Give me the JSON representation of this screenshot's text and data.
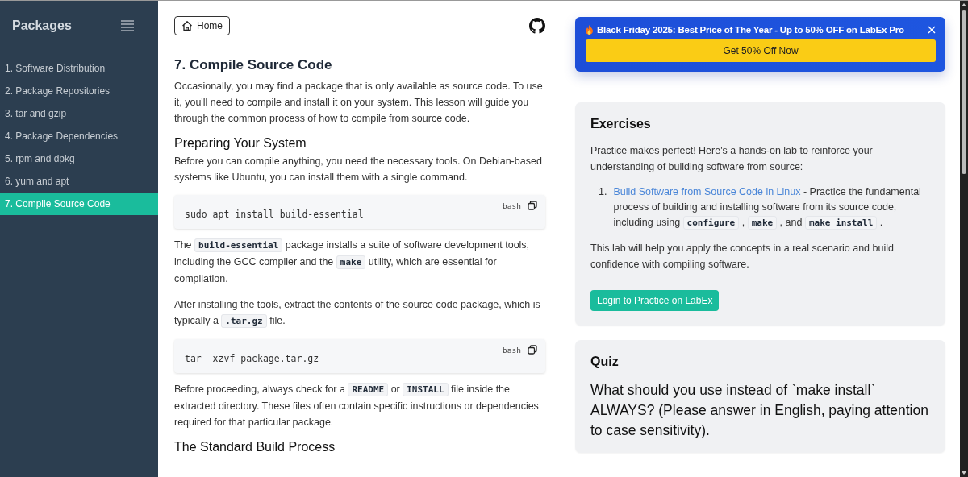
{
  "sidebar": {
    "title": "Packages",
    "items": [
      {
        "label": "1. Software Distribution",
        "selected": false
      },
      {
        "label": "2. Package Repositories",
        "selected": false
      },
      {
        "label": "3. tar and gzip",
        "selected": false
      },
      {
        "label": "4. Package Dependencies",
        "selected": false
      },
      {
        "label": "5. rpm and dpkg",
        "selected": false
      },
      {
        "label": "6. yum and apt",
        "selected": false
      },
      {
        "label": "7. Compile Source Code",
        "selected": true
      }
    ]
  },
  "home_button": "Home",
  "content": [
    {
      "kind": "heading",
      "text": "7. Compile Source Code"
    },
    {
      "kind": "paragraph",
      "segments": [
        {
          "kind": "text",
          "text": "Occasionally, you may find a package that is only available as source code. To use it, you'll need to compile and install it on your system. This lesson will guide you through the common process of how to compile from source code."
        }
      ]
    },
    {
      "kind": "subheading",
      "text": "Preparing Your System"
    },
    {
      "kind": "paragraph",
      "segments": [
        {
          "kind": "text",
          "text": "Before you can compile anything, you need the necessary tools. On Debian-based systems like Ubuntu, you can install them with a single command."
        }
      ]
    },
    {
      "kind": "code",
      "language": "bash",
      "code": "sudo apt install build-essential"
    },
    {
      "kind": "paragraph",
      "segments": [
        {
          "kind": "text",
          "text": "The "
        },
        {
          "kind": "code",
          "text": "build-essential"
        },
        {
          "kind": "text",
          "text": " package installs a suite of software development tools, including the GCC compiler and the "
        },
        {
          "kind": "code",
          "text": "make"
        },
        {
          "kind": "text",
          "text": " utility, which are essential for compilation."
        }
      ]
    },
    {
      "kind": "paragraph",
      "segments": [
        {
          "kind": "text",
          "text": "After installing the tools, extract the contents of the source code package, which is typically a "
        },
        {
          "kind": "code",
          "text": ".tar.gz"
        },
        {
          "kind": "text",
          "text": " file."
        }
      ]
    },
    {
      "kind": "code",
      "language": "bash",
      "code": "tar -xzvf package.tar.gz"
    },
    {
      "kind": "paragraph",
      "segments": [
        {
          "kind": "text",
          "text": "Before proceeding, always check for a "
        },
        {
          "kind": "code",
          "text": "README"
        },
        {
          "kind": "text",
          "text": " or "
        },
        {
          "kind": "code",
          "text": "INSTALL"
        },
        {
          "kind": "text",
          "text": " file inside the extracted directory. These files often contain specific instructions or dependencies required for that particular package."
        }
      ]
    },
    {
      "kind": "subheading",
      "text": "The Standard Build Process"
    }
  ],
  "promo": {
    "text": "Black Friday 2025: Best Price of The Year - Up to 50% OFF on LabEx Pro",
    "button": "Get 50% Off Now"
  },
  "exercises": {
    "title": "Exercises",
    "intro": "Practice makes perfect! Here's a hands-on lab to reinforce your understanding of building software from source:",
    "items": [
      {
        "number": "1.",
        "link": "Build Software from Source Code in Linux",
        "segments": [
          {
            "kind": "text",
            "text": " - Practice the fundamental process of building and installing software from its source code, including using "
          },
          {
            "kind": "code",
            "text": "configure"
          },
          {
            "kind": "text",
            "text": " , "
          },
          {
            "kind": "code",
            "text": "make"
          },
          {
            "kind": "text",
            "text": " , and "
          },
          {
            "kind": "code",
            "text": "make install"
          },
          {
            "kind": "text",
            "text": " ."
          }
        ]
      }
    ],
    "outro": "This lab will help you apply the concepts in a real scenario and build confidence with compiling software.",
    "button": "Login to Practice on LabEx"
  },
  "quiz": {
    "title": "Quiz",
    "question": "What should you use instead of `make install` ALWAYS? (Please answer in English, paying attention to case sensitivity)."
  }
}
